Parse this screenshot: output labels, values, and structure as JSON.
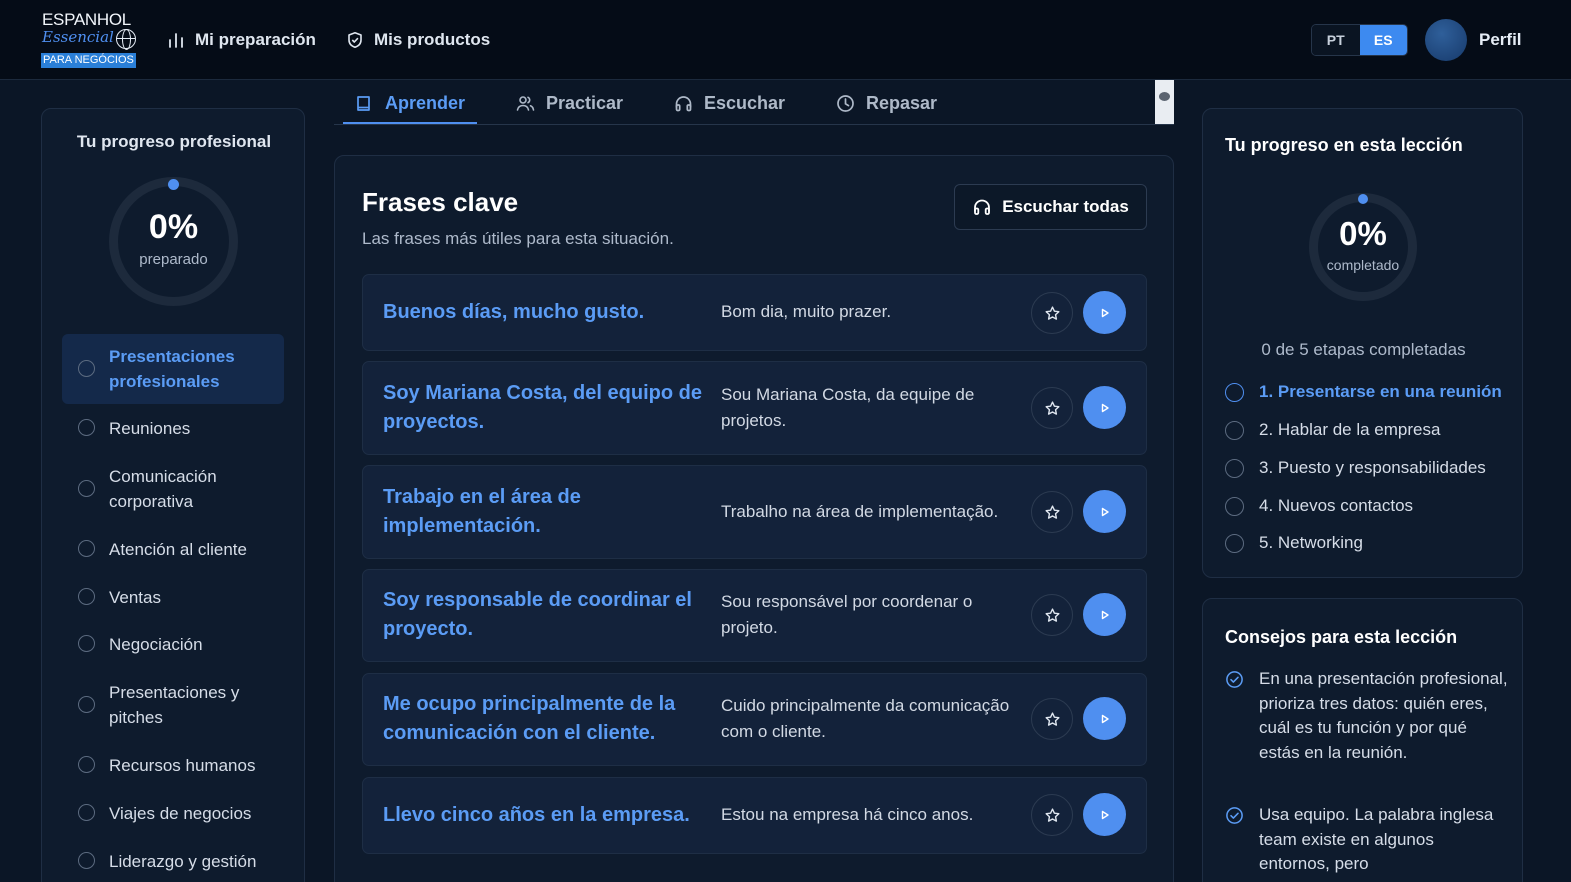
{
  "brand": {
    "line1": "ESPANHOL",
    "line2": "Essencial",
    "tag": "PARA NEGÓCIOS"
  },
  "topnav": {
    "items": [
      {
        "label": "Mi preparación",
        "icon": "bar-chart-icon"
      },
      {
        "label": "Mis productos",
        "icon": "shield-icon"
      }
    ],
    "lang_options": [
      "PT",
      "ES"
    ],
    "lang_selected": "ES",
    "profile_label": "Perfil"
  },
  "sidebar": {
    "title": "Tu progreso profesional",
    "progress": {
      "percent_text": "0%",
      "caption": "preparado",
      "value": 0
    },
    "categories": [
      {
        "label": "Presentaciones profesionales",
        "active": true
      },
      {
        "label": "Reuniones"
      },
      {
        "label": "Comunicación corporativa"
      },
      {
        "label": "Atención al cliente"
      },
      {
        "label": "Ventas"
      },
      {
        "label": "Negociación"
      },
      {
        "label": "Presentaciones y pitches"
      },
      {
        "label": "Recursos humanos"
      },
      {
        "label": "Viajes de negocios"
      },
      {
        "label": "Liderazgo y gestión"
      }
    ]
  },
  "tabs": [
    {
      "label": "Aprender",
      "icon": "book-icon",
      "active": true
    },
    {
      "label": "Practicar",
      "icon": "users-icon"
    },
    {
      "label": "Escuchar",
      "icon": "headphones-icon"
    },
    {
      "label": "Repasar",
      "icon": "clock-icon"
    }
  ],
  "main": {
    "title": "Frases clave",
    "subtitle": "Las frases más útiles para esta situación.",
    "listen_all_label": "Escuchar todas",
    "phrases": [
      {
        "es": "Buenos días, mucho gusto.",
        "pt": "Bom dia, muito prazer."
      },
      {
        "es": "Soy Mariana Costa, del equipo de proyectos.",
        "pt": "Sou Mariana Costa, da equipe de projetos."
      },
      {
        "es": "Trabajo en el área de implementación.",
        "pt": "Trabalho na área de implementação."
      },
      {
        "es": "Soy responsable de coordinar el proyecto.",
        "pt": "Sou responsável por coordenar o projeto."
      },
      {
        "es": "Me ocupo principalmente de la comunicación con el cliente.",
        "pt": "Cuido principalmente da comunicação com o cliente."
      },
      {
        "es": "Llevo cinco años en la empresa.",
        "pt": "Estou na empresa há cinco anos."
      }
    ]
  },
  "lesson_progress": {
    "title": "Tu progreso en esta lección",
    "percent_text": "0%",
    "caption": "completado",
    "value": 0,
    "stages_text": "0 de 5 etapas completadas",
    "steps": [
      {
        "label": "1. Presentarse en una reunión",
        "active": true
      },
      {
        "label": "2. Hablar de la empresa"
      },
      {
        "label": "3. Puesto y responsabilidades"
      },
      {
        "label": "4. Nuevos contactos"
      },
      {
        "label": "5. Networking"
      }
    ]
  },
  "tips": {
    "title": "Consejos para esta lección",
    "items": [
      "En una presentación profesional, prioriza tres datos: quién eres, cuál es tu función y por qué estás en la reunión.",
      "Usa equipo. La palabra inglesa team existe en algunos entornos, pero"
    ]
  },
  "colors": {
    "accent": "#4f8ff0",
    "background": "#0b1626",
    "panel": "#0e1b2d",
    "topbar": "#050c17"
  }
}
